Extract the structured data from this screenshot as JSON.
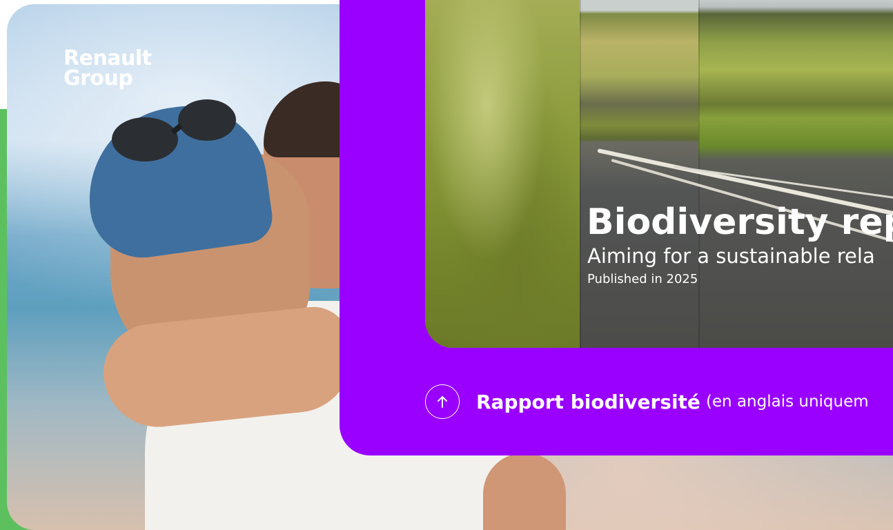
{
  "brand": {
    "logo_line1": "Renault",
    "logo_line2": "Group",
    "purple": "#9900ff",
    "green": "#5cc05f"
  },
  "report_card": {
    "title": "Biodiversity repo",
    "subtitle": "Aiming for a sustainable rela",
    "published": "Published in 2025"
  },
  "download_link": {
    "icon": "arrow-up-icon",
    "label_bold": "Rapport biodiversité",
    "label_light": "(en anglais uniquem"
  }
}
